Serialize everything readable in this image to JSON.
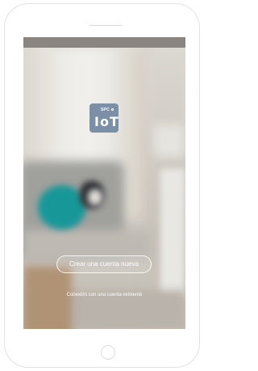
{
  "app": {
    "logo": {
      "brand": "SPC",
      "product": "IoT",
      "color": "#7b8fa6"
    }
  },
  "actions": {
    "create_account_label": "Crear una cuenta nueva",
    "login_label": "Conexión con una cuenta existente"
  },
  "colors": {
    "status_bar": "#8a8580",
    "button_border": "#ffffff",
    "text": "#ffffff"
  }
}
